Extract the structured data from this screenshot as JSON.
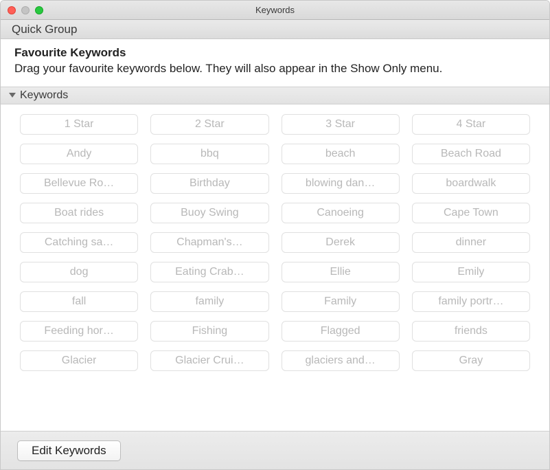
{
  "window": {
    "title": "Keywords"
  },
  "toolbar": {
    "quick_group_label": "Quick Group"
  },
  "favourites": {
    "title": "Favourite Keywords",
    "description": "Drag your favourite keywords below. They will also appear in the Show Only menu."
  },
  "keywords_section": {
    "header": "Keywords",
    "items": [
      "1 Star",
      "2 Star",
      "3 Star",
      "4 Star",
      "Andy",
      "bbq",
      "beach",
      "Beach Road",
      "Bellevue Ro…",
      "Birthday",
      "blowing dan…",
      "boardwalk",
      "Boat rides",
      "Buoy Swing",
      "Canoeing",
      "Cape Town",
      "Catching sa…",
      "Chapman's…",
      "Derek",
      "dinner",
      "dog",
      "Eating Crab…",
      "Ellie",
      "Emily",
      "fall",
      "family",
      "Family",
      "family portr…",
      "Feeding hor…",
      "Fishing",
      "Flagged",
      "friends",
      "Glacier",
      "Glacier Crui…",
      "glaciers and…",
      "Gray"
    ]
  },
  "footer": {
    "edit_button_label": "Edit Keywords"
  }
}
